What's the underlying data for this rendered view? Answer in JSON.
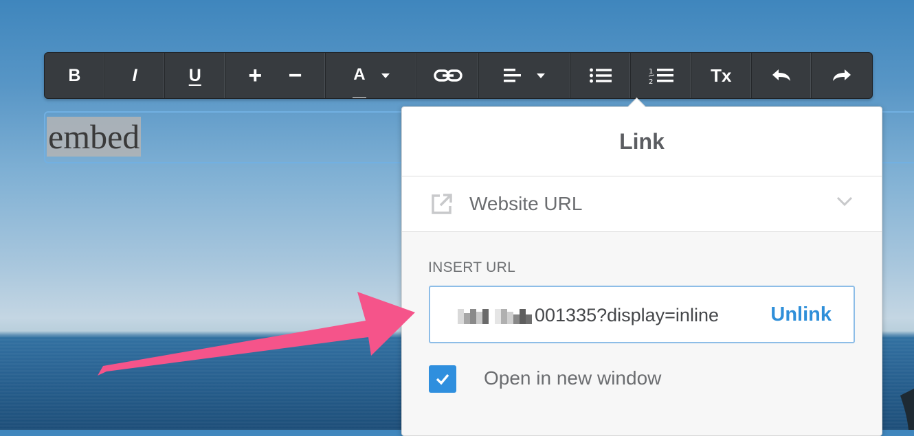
{
  "toolbar": {
    "bold": "B",
    "italic": "I",
    "underline": "U",
    "increase_size": "+",
    "decrease_size": "−",
    "text_color": "A",
    "clear_format": "Tx"
  },
  "editor": {
    "selected_text": "embed"
  },
  "link_panel": {
    "title": "Link",
    "url_type": "Website URL",
    "insert_label": "INSERT URL",
    "url_value": "001335?display=inline",
    "unlink_label": "Unlink",
    "open_new_window_label": "Open in new window",
    "open_new_window_checked": true
  },
  "colors": {
    "toolbar_bg": "#373b3f",
    "accent": "#2f8fde",
    "arrow": "#f5548a"
  },
  "icons": {
    "url_type": "external-link-icon",
    "chevron": "chevron-down-icon"
  }
}
